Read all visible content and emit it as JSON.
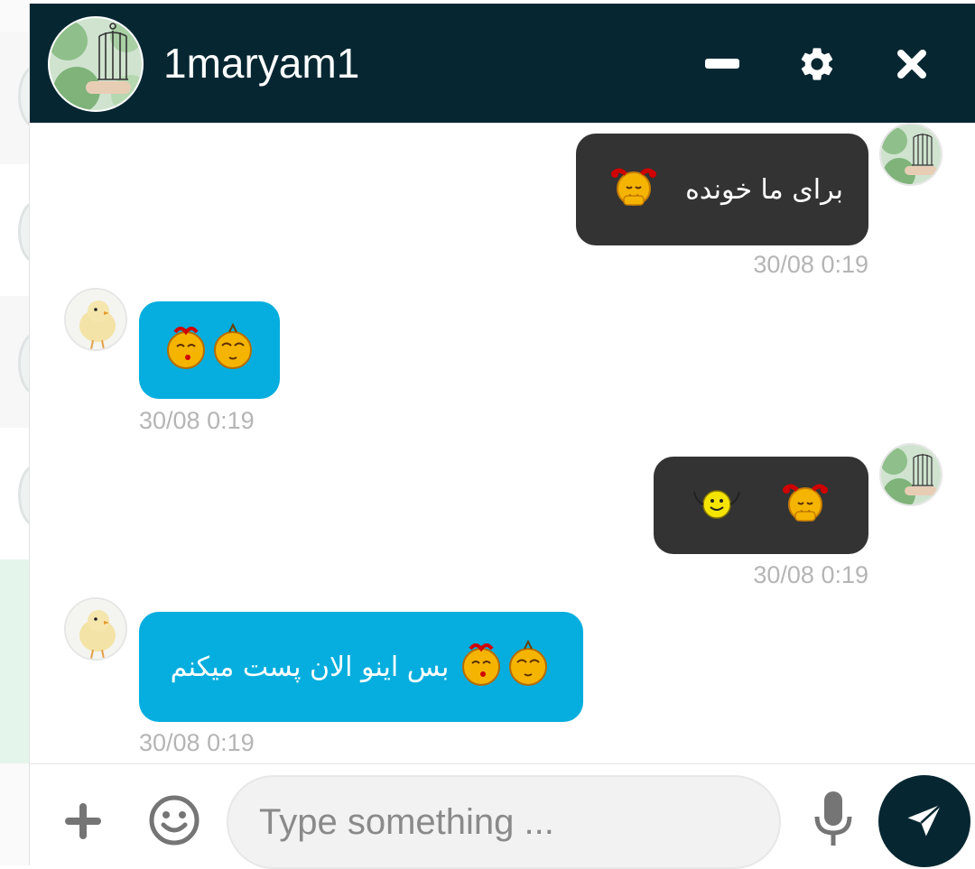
{
  "chat": {
    "contact_name": "1maryam1",
    "header_icons": [
      "minimize-icon",
      "gear-icon",
      "close-icon"
    ]
  },
  "messages": [
    {
      "direction": "outgoing",
      "text": "برای ما خونده",
      "emojis": [
        "blushing-girl-emoji"
      ],
      "time": "30/08 0:19"
    },
    {
      "direction": "incoming",
      "text": "",
      "emojis": [
        "kissing-girl-emoji",
        "kissing-boy-emoji"
      ],
      "time": "30/08 0:19"
    },
    {
      "direction": "outgoing",
      "text": "",
      "emojis": [
        "waving-smiley-emoji",
        "blushing-girl-emoji"
      ],
      "time": "30/08 0:19"
    },
    {
      "direction": "incoming",
      "text": "بس اینو الان پست میکنم",
      "emojis": [
        "kissing-girl-emoji",
        "kissing-boy-emoji"
      ],
      "time": "30/08 0:19"
    }
  ],
  "composer": {
    "placeholder": "Type something ...",
    "icons": [
      "plus-icon",
      "smiley-icon",
      "microphone-icon",
      "send-icon"
    ]
  },
  "colors": {
    "header_bg": "#062732",
    "outgoing_bubble": "#333333",
    "incoming_bubble": "#05aede",
    "timestamp": "#b5b5b5",
    "send_button": "#062732"
  }
}
